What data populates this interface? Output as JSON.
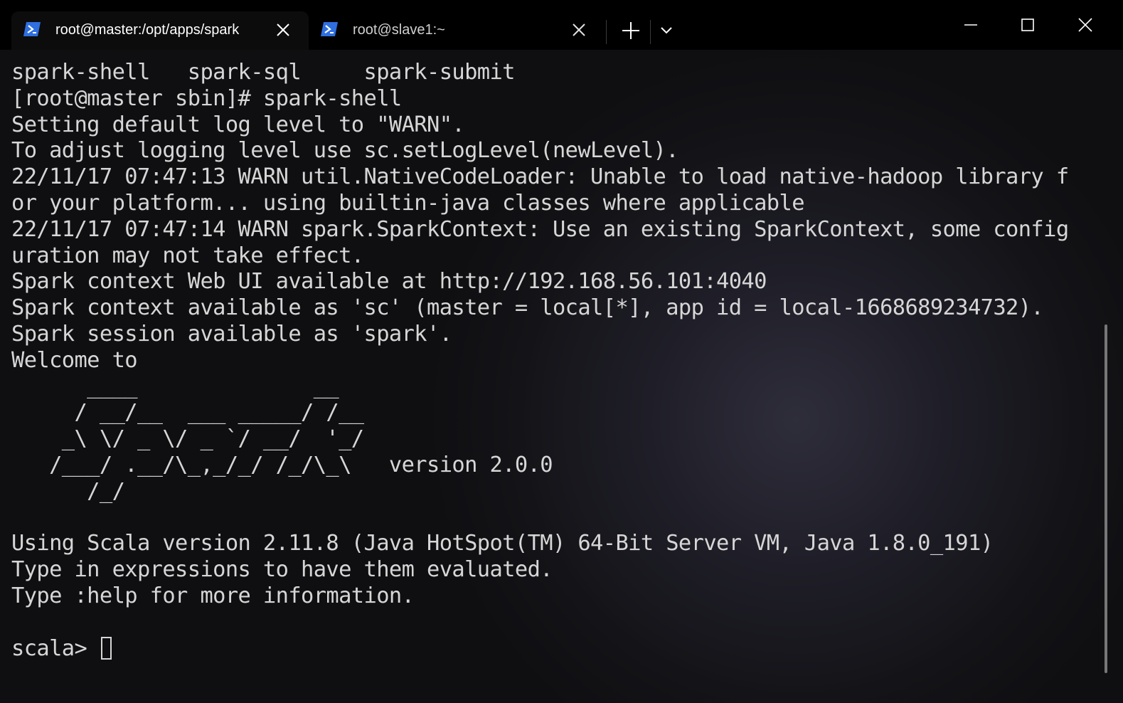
{
  "tabs": [
    {
      "title": "root@master:/opt/apps/spark",
      "icon": "powershell-icon",
      "active": true
    },
    {
      "title": "root@slave1:~",
      "icon": "powershell-icon",
      "active": false
    }
  ],
  "terminal": {
    "lines": [
      "spark-shell   spark-sql     spark-submit",
      "[root@master sbin]# spark-shell",
      "Setting default log level to \"WARN\".",
      "To adjust logging level use sc.setLogLevel(newLevel).",
      "22/11/17 07:47:13 WARN util.NativeCodeLoader: Unable to load native-hadoop library f",
      "or your platform... using builtin-java classes where applicable",
      "22/11/17 07:47:14 WARN spark.SparkContext: Use an existing SparkContext, some config",
      "uration may not take effect.",
      "Spark context Web UI available at http://192.168.56.101:4040",
      "Spark context available as 'sc' (master = local[*], app id = local-1668689234732).",
      "Spark session available as 'spark'.",
      "Welcome to",
      "      ____              __",
      "     / __/__  ___ _____/ /__",
      "    _\\ \\/ _ \\/ _ `/ __/  '_/",
      "   /___/ .__/\\_,_/_/ /_/\\_\\   version 2.0.0",
      "      /_/",
      "",
      "Using Scala version 2.11.8 (Java HotSpot(TM) 64-Bit Server VM, Java 1.8.0_191)",
      "Type in expressions to have them evaluated.",
      "Type :help for more information.",
      ""
    ],
    "prompt": "scala> "
  },
  "colors": {
    "titlebar": "#000000",
    "active_tab": "#0c0c0c",
    "text": "#d6d6d6",
    "icon_blue": "#3b6fd8"
  }
}
